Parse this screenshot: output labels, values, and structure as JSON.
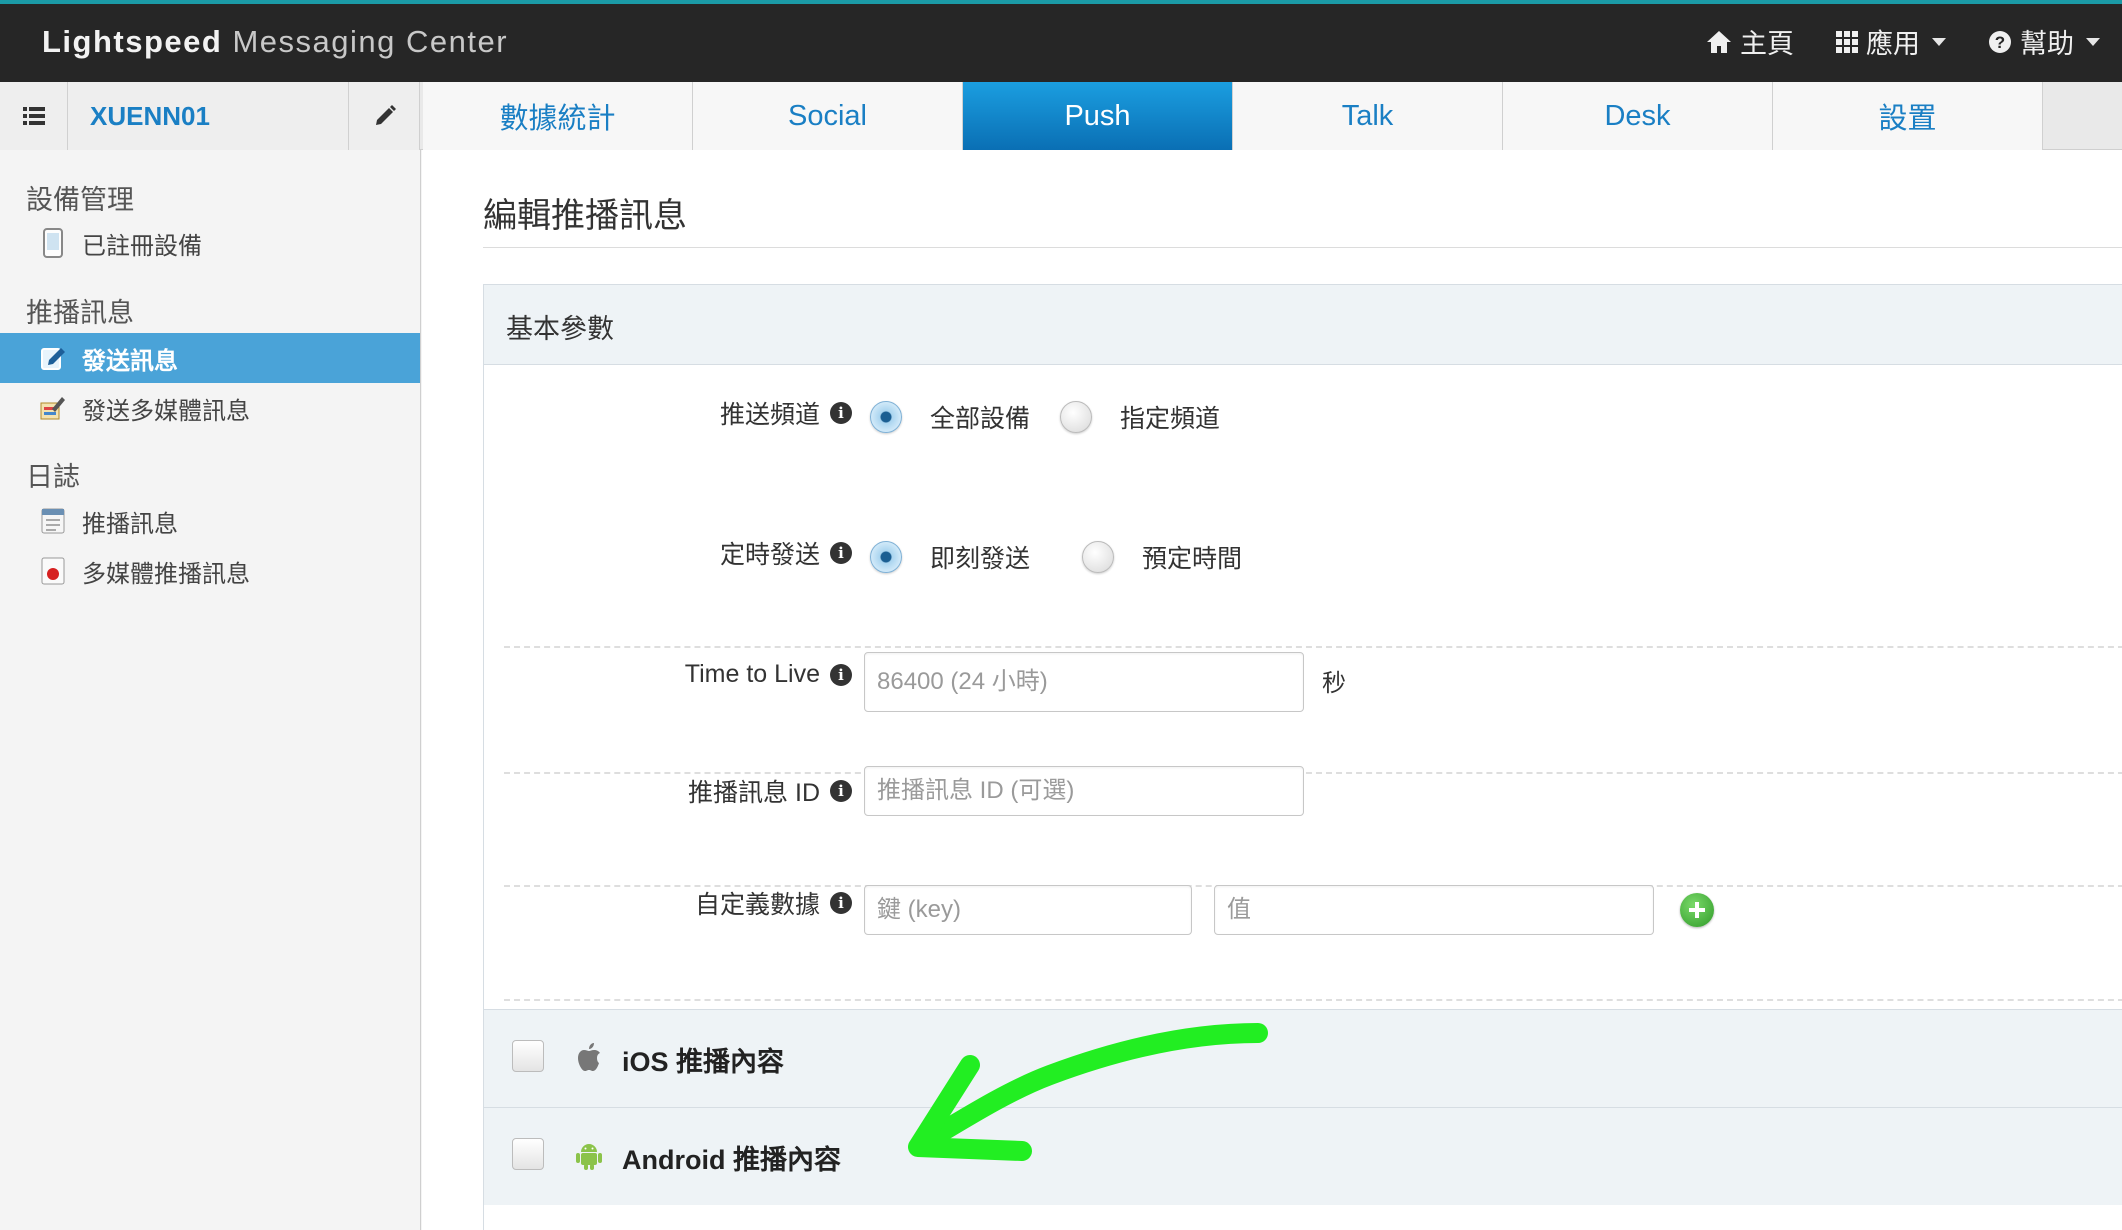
{
  "app": {
    "brand_bold": "Lightspeed",
    "brand_light": "Messaging Center"
  },
  "topnav": {
    "home": "主頁",
    "apps": "應用",
    "help": "幫助"
  },
  "subbar": {
    "app_name": "XUENN01"
  },
  "tabs": [
    {
      "label": "數據統計",
      "active": false
    },
    {
      "label": "Social",
      "active": false
    },
    {
      "label": "Push",
      "active": true
    },
    {
      "label": "Talk",
      "active": false
    },
    {
      "label": "Desk",
      "active": false
    },
    {
      "label": "設置",
      "active": false
    }
  ],
  "sidebar": {
    "groups": [
      {
        "heading": "設備管理",
        "items": [
          {
            "label": "已註冊設備",
            "icon": "device-icon"
          }
        ]
      },
      {
        "heading": "推播訊息",
        "items": [
          {
            "label": "發送訊息",
            "icon": "edit-message-icon",
            "active": true
          },
          {
            "label": "發送多媒體訊息",
            "icon": "multimedia-message-icon"
          }
        ]
      },
      {
        "heading": "日誌",
        "items": [
          {
            "label": "推播訊息",
            "icon": "log-icon"
          },
          {
            "label": "多媒體推播訊息",
            "icon": "multimedia-log-icon"
          }
        ]
      }
    ]
  },
  "main": {
    "title": "編輯推播訊息",
    "panel_title": "基本參數",
    "channel": {
      "label": "推送頻道",
      "options": [
        "全部設備",
        "指定頻道"
      ],
      "selected": "全部設備"
    },
    "schedule": {
      "label": "定時發送",
      "options": [
        "即刻發送",
        "預定時間"
      ],
      "selected": "即刻發送"
    },
    "ttl": {
      "label": "Time to Live",
      "placeholder": "86400 (24 小時)",
      "unit": "秒"
    },
    "push_id": {
      "label": "推播訊息 ID",
      "placeholder": "推播訊息 ID (可選)"
    },
    "custom": {
      "label": "自定義數據",
      "key_placeholder": "鍵 (key)",
      "value_placeholder": "值"
    },
    "ios_section": "iOS 推播內容",
    "android_section": "Android 推播內容"
  },
  "colors": {
    "accent": "#1a7fc4",
    "active_tab": "#0a6fb4",
    "sidebar_active": "#4aa3d8",
    "annotation_arrow": "#22ee22"
  }
}
